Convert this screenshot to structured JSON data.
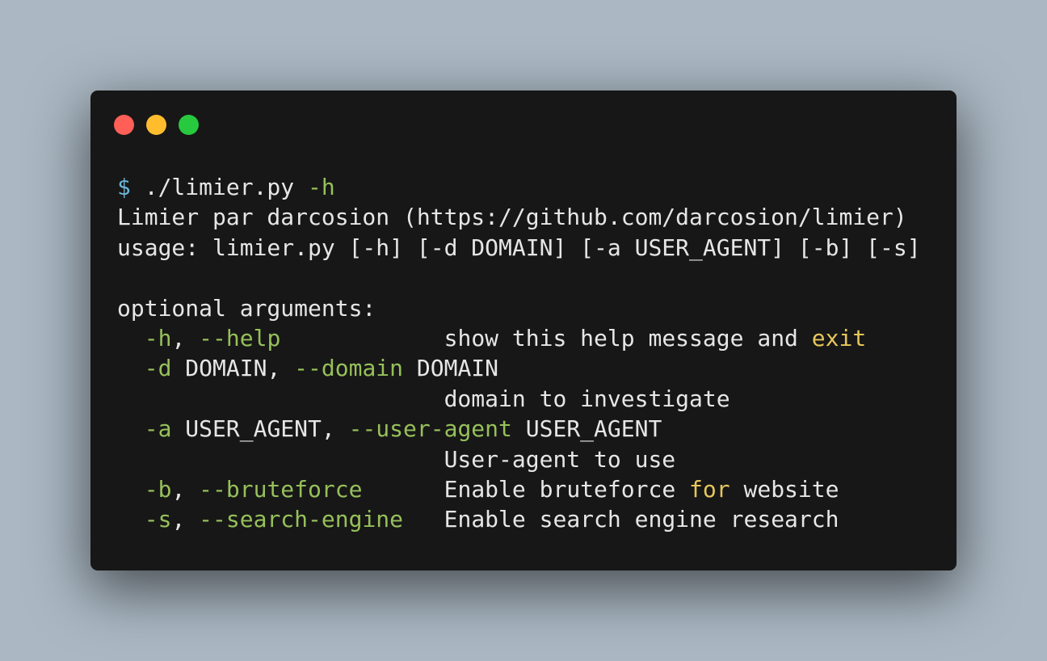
{
  "window": {
    "controls": [
      "close",
      "minimize",
      "maximize"
    ]
  },
  "terminal": {
    "prompt": "$",
    "command_name": " ./limier.py ",
    "command_flag": "-h",
    "banner": "Limier par darcosion (https://github.com/darcosion/limier)",
    "usage": "usage: limier.py [-h] [-d DOMAIN] [-a USER_AGENT] [-b] [-s]",
    "section_header": "optional arguments:",
    "args": {
      "help": {
        "short": "-h",
        "sep": ", ",
        "long": "--help",
        "pad": "            ",
        "desc_text": "show this help message and ",
        "desc_kw": "exit"
      },
      "domain": {
        "short": "-d",
        "metavar1": " DOMAIN, ",
        "long": "--domain",
        "metavar2": " DOMAIN",
        "indent": "                        ",
        "desc": "domain to investigate"
      },
      "user_agent": {
        "short": "-a",
        "metavar1": " USER_AGENT, ",
        "long": "--user-agent",
        "metavar2": " USER_AGENT",
        "indent": "                        ",
        "desc": "User-agent to use"
      },
      "bruteforce": {
        "short": "-b",
        "sep": ", ",
        "long": "--bruteforce",
        "pad": "      ",
        "desc_before": "Enable bruteforce ",
        "desc_kw": "for",
        "desc_after": " website"
      },
      "search_engine": {
        "short": "-s",
        "sep": ", ",
        "long": "--search-engine",
        "pad": "   ",
        "desc": "Enable search engine research"
      }
    }
  },
  "colors": {
    "background": "#abb8c3",
    "window": "#171717",
    "text": "#e6e6e6",
    "prompt": "#6bb6d8",
    "flag": "#96c05a",
    "keyword": "#e7c65b",
    "close": "#ff5f56",
    "minimize": "#ffbd2e",
    "maximize": "#27c93f"
  }
}
